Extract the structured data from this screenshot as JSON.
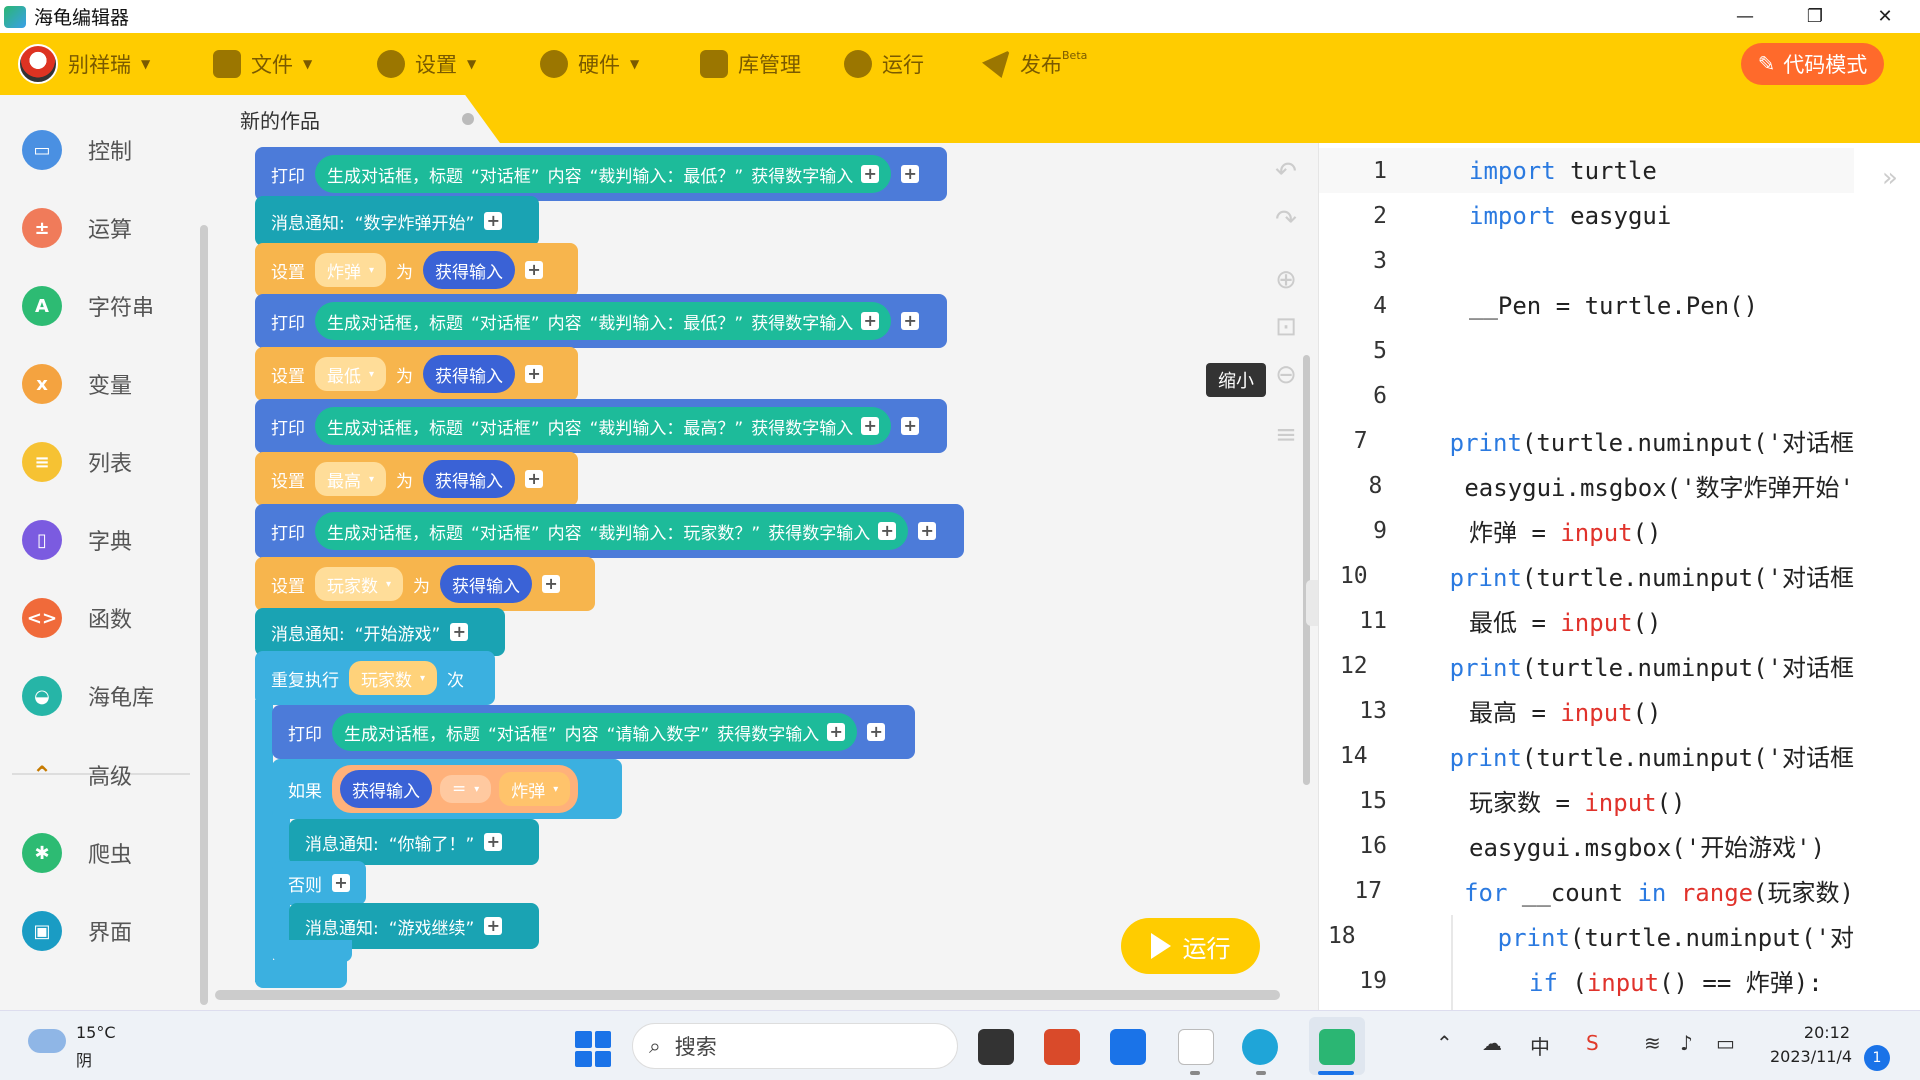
{
  "window": {
    "title": "海龟编辑器"
  },
  "toolbar": {
    "user": "别祥瑞",
    "file": "文件",
    "settings": "设置",
    "hardware": "硬件",
    "library": "库管理",
    "run": "运行",
    "publish": "发布",
    "publish_badge": "Beta",
    "code_mode": "代码模式"
  },
  "sidebar": {
    "items": [
      {
        "label": "控制",
        "icon": "gamepad-icon",
        "color": "#4a90e2"
      },
      {
        "label": "运算",
        "icon": "calculator-icon",
        "color": "#f07b5a"
      },
      {
        "label": "字符串",
        "icon": "string-icon",
        "color": "#2dbb73"
      },
      {
        "label": "变量",
        "icon": "variable-icon",
        "color": "#f4a340"
      },
      {
        "label": "列表",
        "icon": "list-icon",
        "color": "#f6c233"
      },
      {
        "label": "字典",
        "icon": "book-icon",
        "color": "#7b5be0"
      },
      {
        "label": "函数",
        "icon": "function-icon",
        "color": "#f06a3a"
      },
      {
        "label": "海龟库",
        "icon": "turtle-icon",
        "color": "#26b5a7"
      },
      {
        "label": "高级",
        "icon": "chevron-up-icon",
        "color": "#c67a00"
      },
      {
        "label": "爬虫",
        "icon": "spider-icon",
        "color": "#2dbb73"
      },
      {
        "label": "界面",
        "icon": "window-icon",
        "color": "#1a9cc4"
      }
    ]
  },
  "tab": {
    "name": "新的作品"
  },
  "blocks": {
    "print": "打印",
    "msg": "消息通知:",
    "set": "设置",
    "as": "为",
    "get_input": "获得输入",
    "dialog": "生成对话框，标题",
    "dialog_title": "“对话框”",
    "content": "内容",
    "get_number": "获得数字输入",
    "repeat": "重复执行",
    "times": "次",
    "if": "如果",
    "else": "否则",
    "eq": "=",
    "prompt_low": "“裁判输入：最低？”",
    "prompt_high": "“裁判输入：最高？”",
    "prompt_players": "“裁判输入：玩家数？”",
    "prompt_enter": "“请输入数字”",
    "msg_start_bomb": "“数字炸弹开始”",
    "msg_start_game": "“开始游戏”",
    "msg_lost": "“你输了！”",
    "msg_continue": "“游戏继续”",
    "var_bomb": "炸弹",
    "var_low": "最低",
    "var_high": "最高",
    "var_players": "玩家数"
  },
  "workspace": {
    "tooltip": "缩小",
    "run": "运行"
  },
  "code": {
    "lines": [
      {
        "n": "1"
      },
      {
        "n": "2"
      },
      {
        "n": "3"
      },
      {
        "n": "4"
      },
      {
        "n": "5"
      },
      {
        "n": "6"
      },
      {
        "n": "7"
      },
      {
        "n": "8"
      },
      {
        "n": "9"
      },
      {
        "n": "10"
      },
      {
        "n": "11"
      },
      {
        "n": "12"
      },
      {
        "n": "13"
      },
      {
        "n": "14"
      },
      {
        "n": "15"
      },
      {
        "n": "16"
      },
      {
        "n": "17"
      },
      {
        "n": "18"
      },
      {
        "n": "19"
      }
    ],
    "t": {
      "import": "import",
      "turtle": " turtle",
      "easygui": " easygui",
      "pen": "__Pen = turtle.Pen()",
      "print": "print",
      "numinput": "(turtle.numinput('对话框",
      "msgbox1": "easygui.msgbox('数字炸弹开始'",
      "bomb_eq": "炸弹 = ",
      "low_eq": "最低 = ",
      "high_eq": "最高 = ",
      "players_eq": "玩家数 = ",
      "input": "input",
      "parens": "()",
      "msgbox2": "easygui.msgbox('开始游戏')",
      "for": "for",
      "count": " __count ",
      "in": "in",
      "range": " range",
      "range_arg": "(玩家数)",
      "print18": "print",
      "numinput18": "(turtle.numinput('对",
      "if": "if",
      "if_rest_a": " (",
      "if_rest_b": "() == 炸弹):"
    }
  },
  "taskbar": {
    "temp": "15°C",
    "weather": "阴",
    "search": "搜索",
    "ime": "中",
    "time": "20:12",
    "date": "2023/11/4",
    "notifications": "1"
  }
}
